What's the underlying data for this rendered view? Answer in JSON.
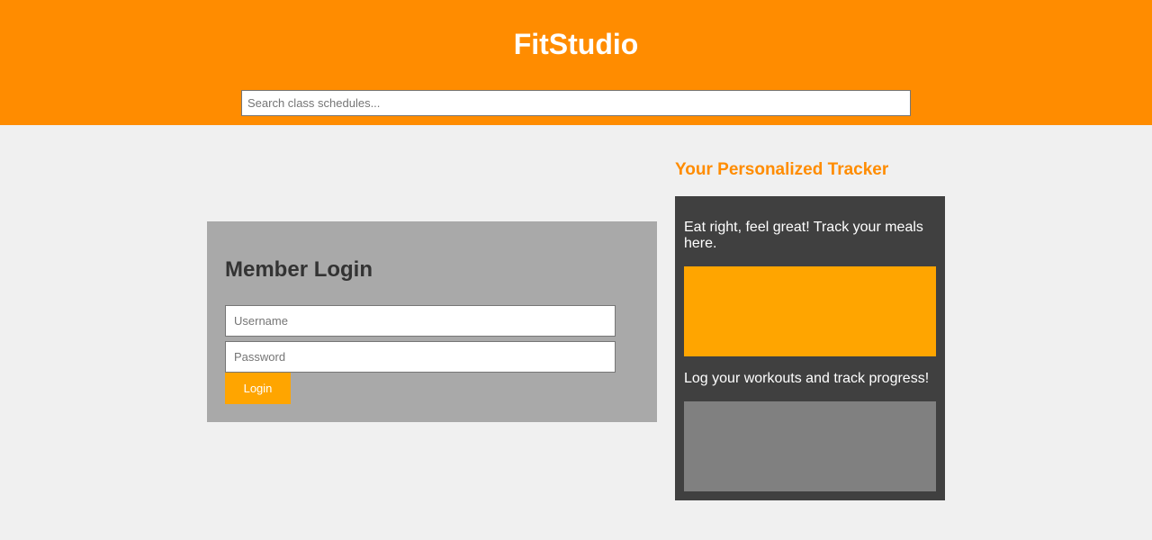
{
  "header": {
    "title": "FitStudio",
    "search": {
      "placeholder": "Search class schedules...",
      "value": ""
    }
  },
  "login": {
    "title": "Member Login",
    "username_placeholder": "Username",
    "password_placeholder": "Password",
    "button_label": "Login"
  },
  "tracker": {
    "heading": "Your Personalized Tracker",
    "meals_text": "Eat right, feel great! Track your meals here.",
    "workouts_text": "Log your workouts and track progress!"
  },
  "colors": {
    "header_bg": "#ff8c00",
    "accent": "#ffa500",
    "panel_gray": "#a9a9a9",
    "tracker_bg": "#404040",
    "workouts_block": "#808080",
    "page_bg": "#f0f0f0"
  }
}
